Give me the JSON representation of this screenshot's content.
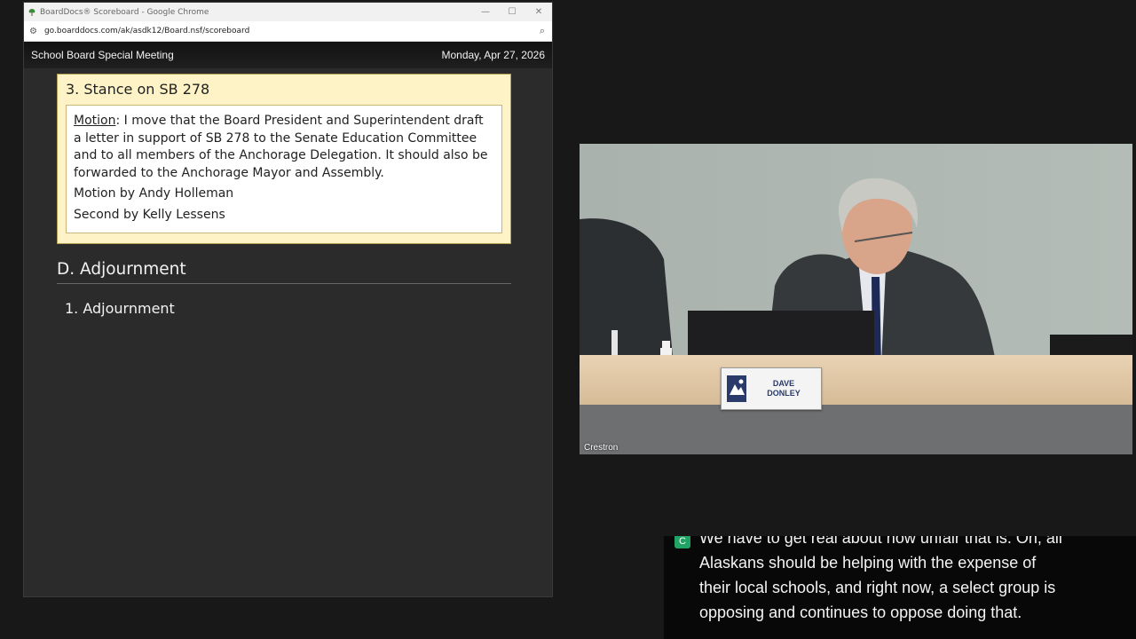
{
  "browser": {
    "tab_title": "BoardDocs® Scoreboard - Google Chrome",
    "url": "go.boarddocs.com/ak/asdk12/Board.nsf/scoreboard",
    "minimize": "—",
    "maximize": "☐",
    "close": "✕"
  },
  "header": {
    "meeting": "School Board Special Meeting",
    "date": "Monday, Apr 27, 2026"
  },
  "item3": {
    "title": "3. Stance on SB 278",
    "motion_label": "Motion",
    "motion_text": ": I move that the Board President and Superintendent draft a letter in support of SB 278 to the Senate Education Committee and to all members of the Anchorage Delegation. It should also be forwarded to the Anchorage Mayor and Assembly.",
    "motion_by": "Motion by Andy Holleman",
    "second_by": "Second by Kelly Lessens"
  },
  "section_d": {
    "title": "D. Adjournment",
    "item": "1. Adjournment"
  },
  "video": {
    "label": "Crestron",
    "nameplate_first": "DAVE",
    "nameplate_last": "DONLEY"
  },
  "caption": {
    "badge": "C",
    "lines": [
      "We have to get real about how unfair that is. Oh, all",
      "Alaskans should be helping with the expense of",
      "their local schools, and right now, a select group is",
      "opposing and continues to oppose doing that."
    ]
  },
  "colors": {
    "card_bg": "#fdf3c6",
    "app_bg": "#2b2b2b",
    "caption_badge": "#21a366"
  }
}
